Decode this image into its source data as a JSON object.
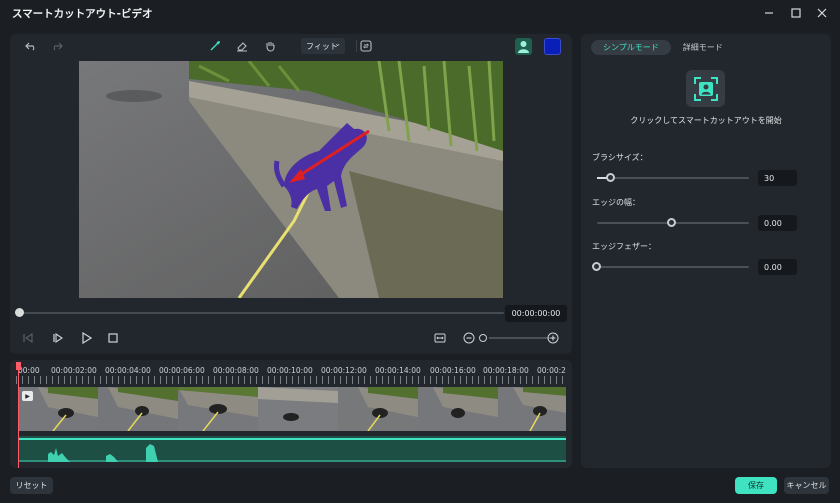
{
  "window": {
    "title": "スマートカットアウト-ビデオ",
    "minimize_icon": "minimize-icon",
    "maximize_icon": "maximize-icon",
    "close_icon": "close-icon"
  },
  "toolbar": {
    "fit_label": "フィット",
    "icons": [
      "undo-icon",
      "redo-icon",
      "brush-icon",
      "eraser-icon",
      "hand-icon",
      "chevron-down-icon",
      "swap-icon",
      "person-silhouette-icon"
    ],
    "swatch_colors": [
      "#1f5f4e",
      "#0a1fb8"
    ]
  },
  "playback": {
    "timecode": "00:00:00:00",
    "progress": 0
  },
  "timeline": {
    "ticks": [
      "00:00",
      "00:00:02:00",
      "00:00:04:00",
      "00:00:06:00",
      "00:00:08:00",
      "00:00:10:00",
      "00:00:12:00",
      "00:00:14:00",
      "00:00:16:00",
      "00:00:18:00",
      "00:00:2"
    ]
  },
  "side": {
    "tabs": [
      "シンプルモード",
      "詳細モード"
    ],
    "active_tab": "シンプルモード",
    "cutout_label": "クリックしてスマートカットアウトを開始",
    "params": [
      {
        "label": "ブラシサイズ：",
        "value": "30",
        "level": 0.06
      },
      {
        "label": "エッジの幅：",
        "value": "0.00",
        "level": 0.5
      },
      {
        "label": "エッジフェザー：",
        "value": "0.00",
        "level": 0
      }
    ]
  },
  "footer": {
    "reset": "リセット",
    "save": "保存",
    "cancel": "キャンセル"
  },
  "colors": {
    "accent": "#3fe3c1",
    "playhead": "#ff5b6b",
    "background": "#1b1f24",
    "panel": "#22272d"
  }
}
